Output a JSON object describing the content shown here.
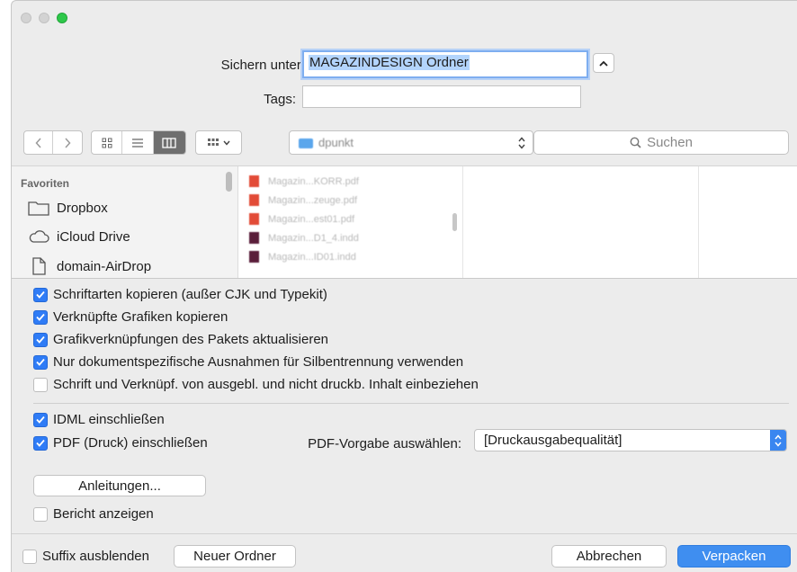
{
  "save": {
    "label": "Sichern unter:",
    "value": "MAGAZINDESIGN Ordner",
    "tags_label": "Tags:",
    "tags_value": ""
  },
  "toolbar": {
    "location": "dpunkt",
    "search_placeholder": "Suchen"
  },
  "sidebar": {
    "heading": "Favoriten",
    "items": [
      {
        "label": "Dropbox",
        "icon": "folder-icon"
      },
      {
        "label": "iCloud Drive",
        "icon": "cloud-icon"
      },
      {
        "label": "domain-AirDrop",
        "icon": "document-icon"
      }
    ]
  },
  "files": [
    {
      "name": "Magazin...KORR.pdf",
      "type": "pdf"
    },
    {
      "name": "Magazin...zeuge.pdf",
      "type": "pdf"
    },
    {
      "name": "Magazin...est01.pdf",
      "type": "pdf"
    },
    {
      "name": "Magazin...D1_4.indd",
      "type": "indd"
    },
    {
      "name": "Magazin...ID01.indd",
      "type": "indd"
    }
  ],
  "options": [
    {
      "label": "Schriftarten kopieren (außer CJK und Typekit)",
      "checked": true
    },
    {
      "label": "Verknüpfte Grafiken kopieren",
      "checked": true
    },
    {
      "label": "Grafikverknüpfungen des Pakets aktualisieren",
      "checked": true
    },
    {
      "label": "Nur dokumentspezifische Ausnahmen für Silbentrennung verwenden",
      "checked": true
    },
    {
      "label": "Schrift und Verknüpf. von ausgebl. und nicht druckb. Inhalt einbeziehen",
      "checked": false
    }
  ],
  "include": {
    "idml_label": "IDML einschließen",
    "idml_checked": true,
    "pdf_label": "PDF (Druck) einschließen",
    "pdf_checked": true,
    "preset_label": "PDF-Vorgabe auswählen:",
    "preset_value": "[Druckausgabequalität]"
  },
  "instructions_button": "Anleitungen...",
  "report": {
    "label": "Bericht anzeigen",
    "checked": false
  },
  "footer": {
    "hide_ext_label": "Suffix ausblenden",
    "hide_ext_checked": false,
    "new_folder": "Neuer Ordner",
    "cancel": "Abbrechen",
    "package": "Verpacken"
  },
  "colors": {
    "accent": "#2f7cf6",
    "zoom": "#2ec84a",
    "primary_button": "#3f8ef0"
  }
}
